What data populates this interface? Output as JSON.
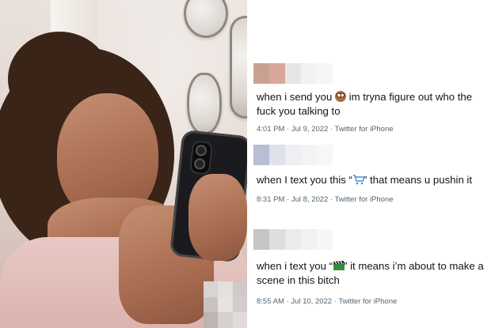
{
  "tweets": [
    {
      "text_before": "when i send you ",
      "emoji": "owl-emoji",
      "text_after": " im tryna figure out who the fuck you talking to",
      "time": "4:01 PM",
      "date": "Jul 9, 2022",
      "client": "Twitter for iPhone",
      "avatar_colors": [
        "#c9a28f",
        "#d8a79a",
        "#e6e6e6",
        "#f2f2f2",
        "#f6f6f6"
      ]
    },
    {
      "text_before": "when I text you this “",
      "emoji": "shopping-cart-emoji",
      "text_after": "” that means u pushin it",
      "time": "8:31 PM",
      "date": "Jul 8, 2022",
      "client": "Twitter for iPhone",
      "avatar_colors": [
        "#b9bdd6",
        "#dfe1ec",
        "#eeeef3",
        "#f3f3f5",
        "#f7f7f7"
      ]
    },
    {
      "text_before": "when i text you “",
      "emoji": "clapper-board-emoji",
      "text_after": "” it means i’m about to make a scene in this bitch",
      "time": "8:55 AM",
      "date": "Jul 10, 2022",
      "client": "Twitter for iPhone",
      "avatar_colors": [
        "#c7c4c4",
        "#e0dddd",
        "#ebebeb",
        "#f1f1f1",
        "#f6f6f6"
      ]
    }
  ],
  "separator": "·",
  "colors": {
    "tweet_text": "#0f1419",
    "meta_text": "#536471"
  }
}
